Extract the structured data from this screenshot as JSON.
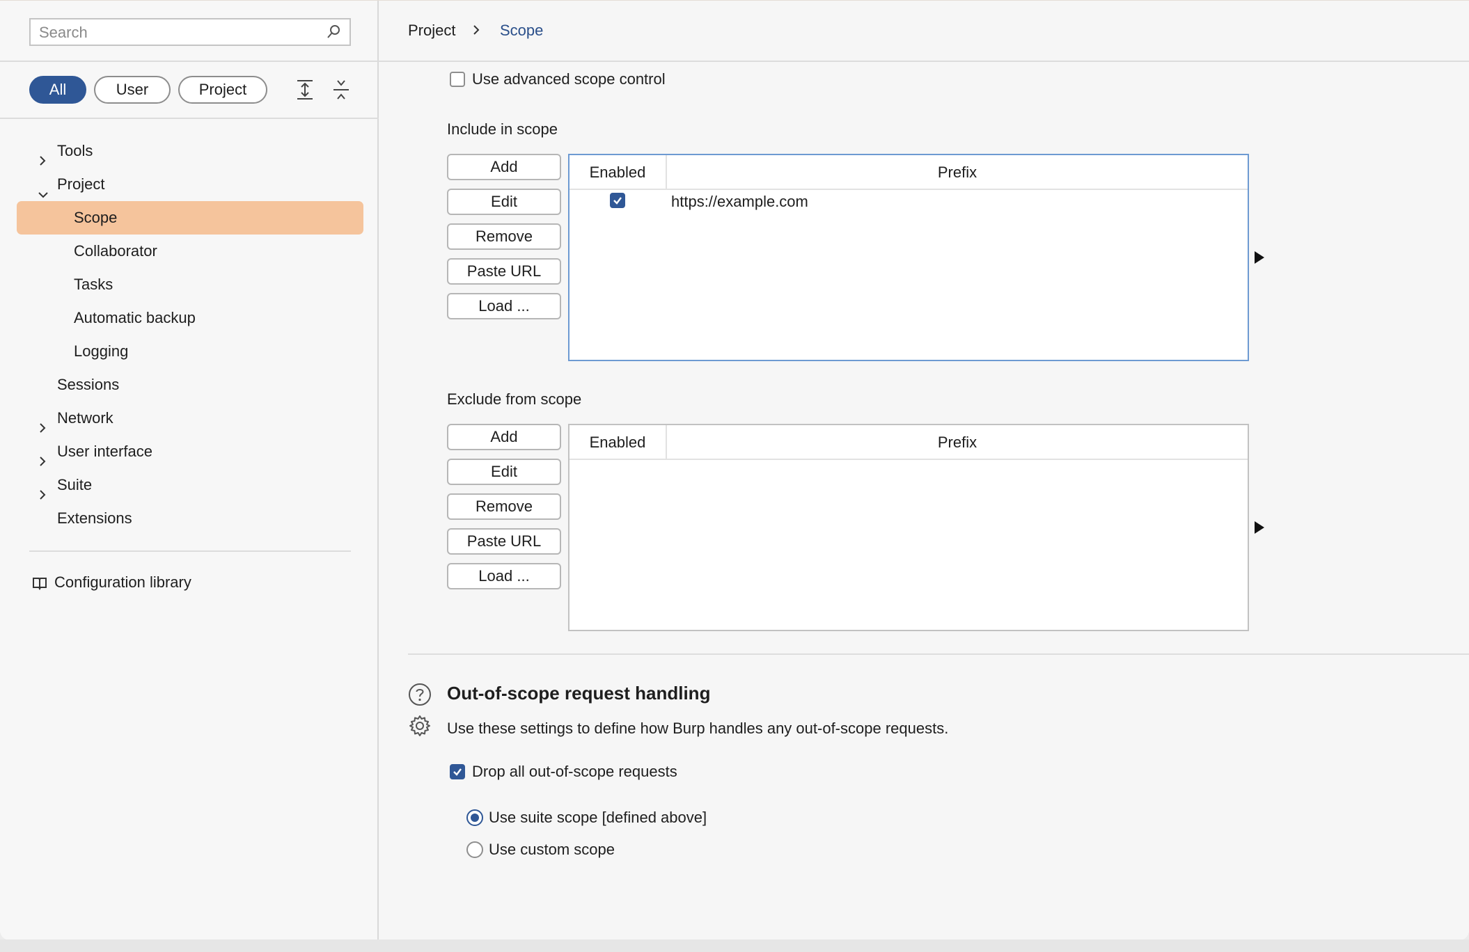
{
  "sidebar": {
    "search": {
      "placeholder": "Search"
    },
    "filters": [
      "All",
      "User",
      "Project"
    ],
    "tree": {
      "tools": "Tools",
      "project": "Project",
      "scope": "Scope",
      "collaborator": "Collaborator",
      "tasks": "Tasks",
      "automatic_backup": "Automatic backup",
      "logging": "Logging",
      "sessions": "Sessions",
      "network": "Network",
      "user_interface": "User interface",
      "suite": "Suite",
      "extensions": "Extensions"
    },
    "config_library": "Configuration library"
  },
  "breadcrumb": {
    "parent": "Project",
    "current": "Scope"
  },
  "scope": {
    "advanced_label": "Use advanced scope control",
    "advanced_checked": false,
    "include": {
      "title": "Include in scope",
      "buttons": [
        "Add",
        "Edit",
        "Remove",
        "Paste URL",
        "Load ..."
      ],
      "columns": [
        "Enabled",
        "Prefix"
      ],
      "rows": [
        {
          "enabled": true,
          "prefix": "https://example.com"
        }
      ]
    },
    "exclude": {
      "title": "Exclude from scope",
      "buttons": [
        "Add",
        "Edit",
        "Remove",
        "Paste URL",
        "Load ..."
      ],
      "columns": [
        "Enabled",
        "Prefix"
      ],
      "rows": []
    }
  },
  "out_of_scope": {
    "title": "Out-of-scope request handling",
    "description": "Use these settings to define how Burp handles any out-of-scope requests.",
    "drop_label": "Drop all out-of-scope requests",
    "drop_checked": true,
    "radio_suite": "Use suite scope [defined above]",
    "radio_custom": "Use custom scope",
    "selected": "suite"
  },
  "colors": {
    "accent": "#2f5796",
    "selection": "#f5c49c",
    "breadcrumb_current": "#2a4f8a"
  }
}
